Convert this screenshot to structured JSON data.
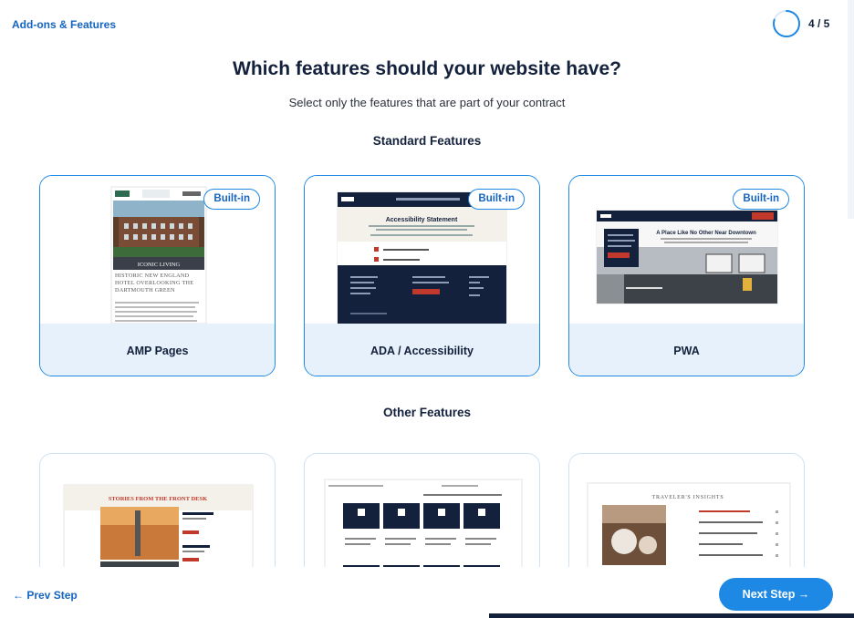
{
  "header": {
    "step_title": "Add-ons & Features",
    "progress_text": "4 / 5",
    "progress_fraction": 0.8
  },
  "main": {
    "heading": "Which features should your website have?",
    "subheading": "Select only the features that are part of your contract",
    "standard_title": "Standard Features",
    "other_title": "Other Features",
    "standard_features": [
      {
        "label": "AMP Pages",
        "badge": "Built-in"
      },
      {
        "label": "ADA / Accessibility",
        "badge": "Built-in"
      },
      {
        "label": "PWA",
        "badge": "Built-in"
      }
    ],
    "previews": {
      "amp": {
        "title": "HISTORIC NEW ENGLAND HOTEL OVERLOOKING THE DARTMOUTH GREEN",
        "caption": "ICONIC LIVING"
      },
      "ada": {
        "title": "Accessibility Statement"
      },
      "pwa": {
        "title": "A Place Like No Other Near Downtown"
      },
      "stories": {
        "title": "STORIES FROM THE FRONT DESK"
      },
      "travelers": {
        "title": "TRAVELER'S INSIGHTS"
      }
    }
  },
  "footer": {
    "prev_label": "← Prev Step",
    "next_label": "Next Step →"
  },
  "colors": {
    "accent": "#1e88e5",
    "navy": "#14213d",
    "label_bg": "#e7f1fb"
  }
}
